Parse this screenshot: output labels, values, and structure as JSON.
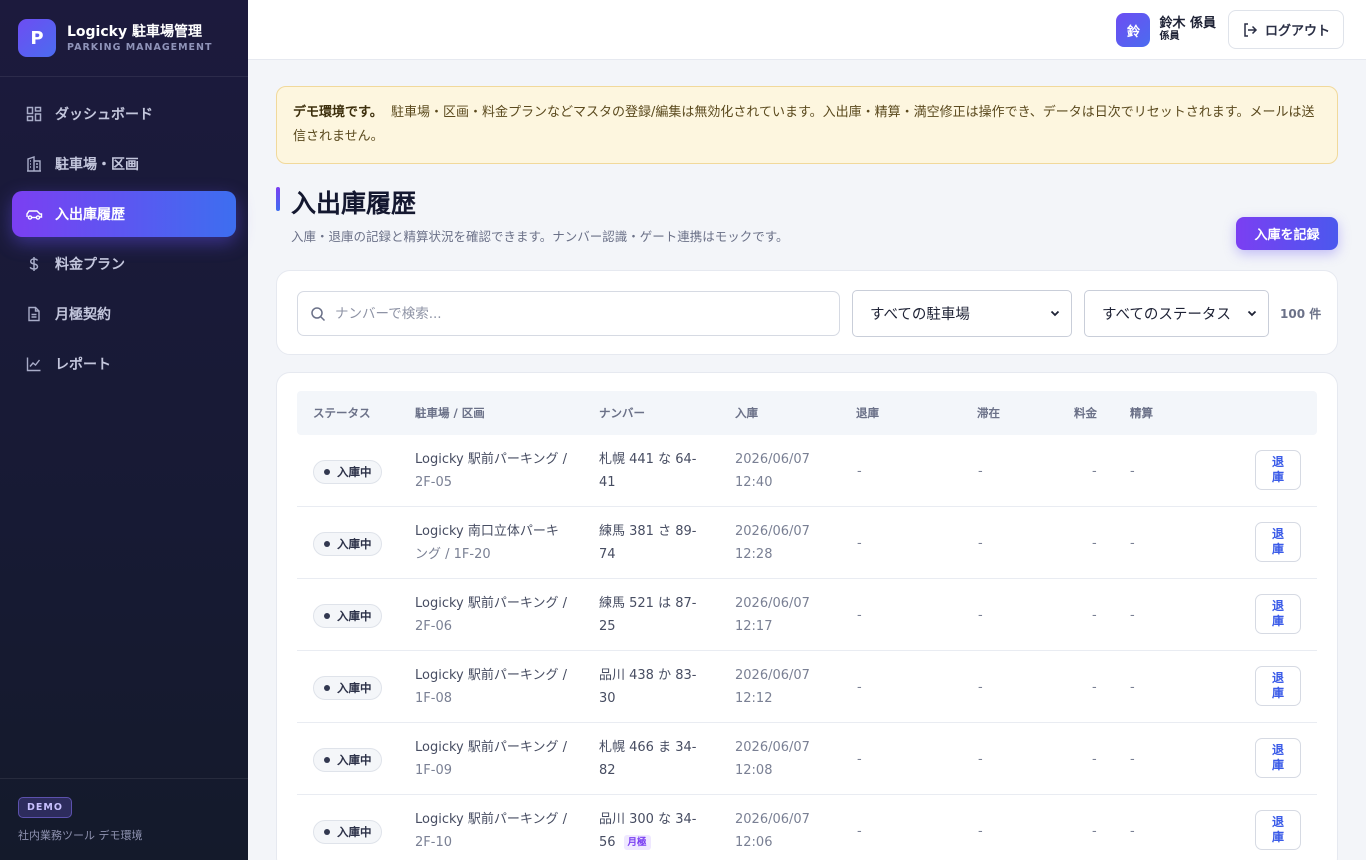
{
  "brand": {
    "logo": "P",
    "title": "Logicky 駐車場管理",
    "subtitle": "PARKING MANAGEMENT"
  },
  "sidebar": {
    "items": [
      {
        "label": "ダッシュボード",
        "icon": "dashboard-icon",
        "active": false
      },
      {
        "label": "駐車場・区画",
        "icon": "building-icon",
        "active": false
      },
      {
        "label": "入出庫履歴",
        "icon": "car-icon",
        "active": true
      },
      {
        "label": "料金プラン",
        "icon": "dollar-icon",
        "active": false
      },
      {
        "label": "月極契約",
        "icon": "document-icon",
        "active": false
      },
      {
        "label": "レポート",
        "icon": "chart-icon",
        "active": false
      }
    ],
    "footer_badge": "DEMO",
    "footer_text": "社内業務ツール デモ環境"
  },
  "header": {
    "avatar": "鈴",
    "user_name": "鈴木 係員",
    "user_role": "係員",
    "logout_label": "ログアウト"
  },
  "notice": {
    "strong": "デモ環境です。",
    "text": "駐車場・区画・料金プランなどマスタの登録/編集は無効化されています。入出庫・精算・満空修正は操作でき、データは日次でリセットされます。メールは送信されません。"
  },
  "page": {
    "title": "入出庫履歴",
    "subtitle": "入庫・退庫の記録と精算状況を確認できます。ナンバー認識・ゲート連携はモックです。",
    "record_button": "入庫を記録"
  },
  "filters": {
    "search_placeholder": "ナンバーで検索...",
    "parking_select": "すべての駐車場",
    "status_select": "すべてのステータス",
    "count": "100 件"
  },
  "table": {
    "headers": [
      "ステータス",
      "駐車場 / 区画",
      "ナンバー",
      "入庫",
      "退庫",
      "滞在",
      "料金",
      "精算"
    ],
    "rows": [
      {
        "status": "入庫中",
        "parking1": "Logicky 駅前パーキング /",
        "parking2": "2F-05",
        "plate1": "札幌 441 な 64-",
        "plate2": "41",
        "tag": "",
        "entry1": "2026/06/07",
        "entry2": "12:40",
        "exit": "-",
        "stay": "-",
        "fee": "-",
        "settle": "-",
        "action": "退庫"
      },
      {
        "status": "入庫中",
        "parking1": "Logicky 南口立体パーキ",
        "parking2": "ング / 1F-20",
        "plate1": "練馬 381 さ 89-",
        "plate2": "74",
        "tag": "",
        "entry1": "2026/06/07",
        "entry2": "12:28",
        "exit": "-",
        "stay": "-",
        "fee": "-",
        "settle": "-",
        "action": "退庫"
      },
      {
        "status": "入庫中",
        "parking1": "Logicky 駅前パーキング /",
        "parking2": "2F-06",
        "plate1": "練馬 521 は 87-",
        "plate2": "25",
        "tag": "",
        "entry1": "2026/06/07",
        "entry2": "12:17",
        "exit": "-",
        "stay": "-",
        "fee": "-",
        "settle": "-",
        "action": "退庫"
      },
      {
        "status": "入庫中",
        "parking1": "Logicky 駅前パーキング /",
        "parking2": "1F-08",
        "plate1": "品川 438 か 83-",
        "plate2": "30",
        "tag": "",
        "entry1": "2026/06/07",
        "entry2": "12:12",
        "exit": "-",
        "stay": "-",
        "fee": "-",
        "settle": "-",
        "action": "退庫"
      },
      {
        "status": "入庫中",
        "parking1": "Logicky 駅前パーキング /",
        "parking2": "1F-09",
        "plate1": "札幌 466 ま 34-",
        "plate2": "82",
        "tag": "",
        "entry1": "2026/06/07",
        "entry2": "12:08",
        "exit": "-",
        "stay": "-",
        "fee": "-",
        "settle": "-",
        "action": "退庫"
      },
      {
        "status": "入庫中",
        "parking1": "Logicky 駅前パーキング /",
        "parking2": "2F-10",
        "plate1": "品川 300 な 34-",
        "plate2": "56",
        "tag": "月極",
        "entry1": "2026/06/07",
        "entry2": "12:06",
        "exit": "-",
        "stay": "-",
        "fee": "-",
        "settle": "-",
        "action": "退庫"
      }
    ]
  }
}
